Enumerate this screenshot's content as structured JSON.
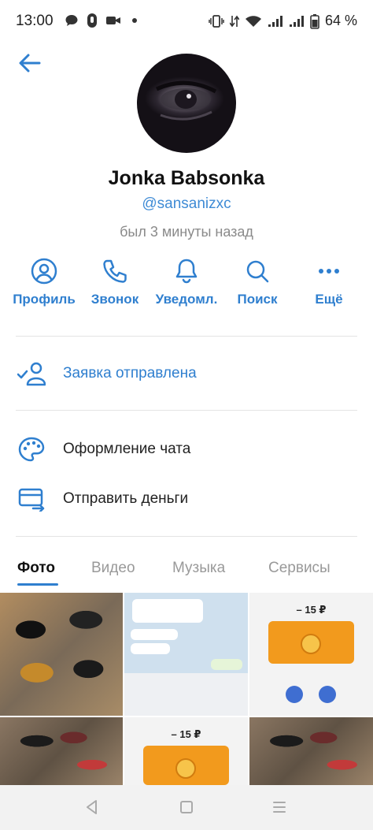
{
  "status_bar": {
    "time": "13:00",
    "battery": "64 %",
    "icons": [
      "message-icon",
      "mic-icon",
      "video-icon",
      "dot-icon",
      "vibrate-icon",
      "data-icon",
      "wifi-icon",
      "signal-icon",
      "signal-icon",
      "battery-icon"
    ]
  },
  "profile": {
    "name": "Jonka Babsonka",
    "username": "@sansanizxc",
    "last_seen": "был 3 минуты назад"
  },
  "actions": [
    {
      "label": "Профиль",
      "icon": "user-circle-icon"
    },
    {
      "label": "Звонок",
      "icon": "phone-icon"
    },
    {
      "label": "Уведомл.",
      "icon": "bell-icon"
    },
    {
      "label": "Поиск",
      "icon": "search-icon"
    },
    {
      "label": "Ещё",
      "icon": "more-dots-icon"
    }
  ],
  "menu": {
    "request": {
      "label": "Заявка отправлена",
      "icon": "user-check-icon"
    },
    "chat_design": {
      "label": "Оформление чата",
      "icon": "palette-icon"
    },
    "send_money": {
      "label": "Отправить деньги",
      "icon": "money-transfer-icon"
    }
  },
  "media_tabs": [
    {
      "label": "Фото",
      "active": true
    },
    {
      "label": "Видео",
      "active": false
    },
    {
      "label": "Музыка",
      "active": false
    },
    {
      "label": "Сервисы",
      "active": false
    }
  ],
  "photos": {
    "amount": "– 15 ₽",
    "thumbnails": [
      "cars-thumbnail",
      "chat-screenshot-thumbnail",
      "payment-screenshot-thumbnail",
      "cars-thumbnail",
      "payment-screenshot-thumbnail",
      "cars-thumbnail"
    ]
  },
  "nav_bar": {
    "icons": [
      "back-triangle-icon",
      "home-square-icon",
      "recents-lines-icon"
    ]
  },
  "colors": {
    "accent": "#2f7fcf",
    "username": "#3f8bd5",
    "muted": "#8a8a8a",
    "payment_card": "#f29a1d"
  }
}
